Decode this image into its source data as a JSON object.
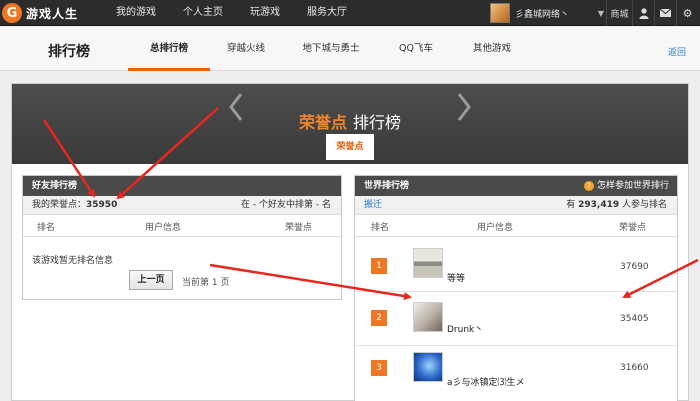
{
  "topbar": {
    "logo_letter": "G",
    "logo_text": "游戏人生",
    "nav": [
      "我的游戏",
      "个人主页",
      "玩游戏",
      "服务大厅"
    ],
    "user_name": "彡鑫城网络丶",
    "mall": "商城"
  },
  "subheader": {
    "title": "排行榜",
    "tabs": [
      "总排行榜",
      "穿越火线",
      "地下城与勇士",
      "QQ飞车",
      "其他游戏"
    ],
    "active_tab": 0,
    "back": "返回"
  },
  "banner": {
    "title_accent": "荣誉点",
    "title_rest": "排行榜",
    "button": "荣誉点"
  },
  "friends": {
    "title": "好友排行榜",
    "my_points_label": "我的荣誉点：",
    "my_points_value": "35950",
    "rank_text": "在 - 个好友中排第 - 名",
    "columns": [
      "排名",
      "用户信息",
      "荣誉点"
    ],
    "empty_text": "该游戏暂无排名信息",
    "prev_page": "上一页",
    "page_info": "当前第  1  页"
  },
  "world": {
    "title": "世界排行榜",
    "how_link": "怎样参加世界排行",
    "how_icon": "?",
    "moved_link": "搬迁",
    "participants_prefix": "有",
    "participants_count": "293,419",
    "participants_suffix": "人参与排名",
    "columns": [
      "排名",
      "用户信息",
      "荣誉点"
    ],
    "rows": [
      {
        "rank": "1",
        "name": "等等",
        "score": "37690"
      },
      {
        "rank": "2",
        "name": "Drunk丶",
        "score": "35405"
      },
      {
        "rank": "3",
        "name": "a彡与冰镇定⑶生メ",
        "score": "31660"
      }
    ]
  },
  "colors": {
    "accent": "#f07722",
    "link": "#2c7cc9",
    "annotation": "#e8261e"
  }
}
